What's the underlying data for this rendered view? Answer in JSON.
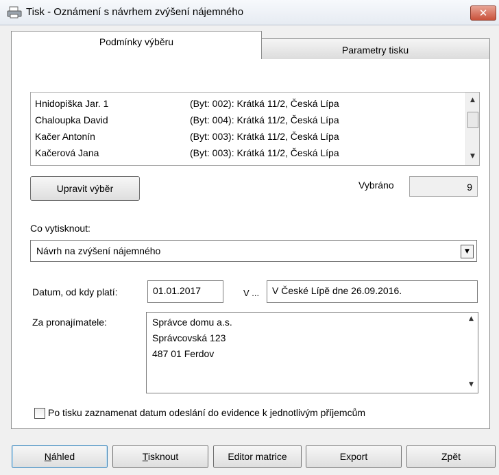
{
  "window": {
    "title": "Tisk - Oznámení s návrhem zvýšení nájemného",
    "close_glyph": "✕"
  },
  "tabs": [
    {
      "label": "Podmínky výběru",
      "active": true
    },
    {
      "label": "Parametry tisku",
      "active": false
    }
  ],
  "list": {
    "rows": [
      {
        "name": "Hnidopiška Jar. 1",
        "address": "(Byt: 002): Krátká 11/2, Česká Lípa"
      },
      {
        "name": "Chaloupka David",
        "address": "(Byt: 004): Krátká 11/2, Česká Lípa"
      },
      {
        "name": "Kačer Antonín",
        "address": "(Byt: 003): Krátká 11/2, Česká Lípa"
      },
      {
        "name": "Kačerová Jana",
        "address": "(Byt: 003): Krátká 11/2, Česká Lípa"
      }
    ],
    "scroll_up": "▲",
    "scroll_down": "▼"
  },
  "selection": {
    "edit_button": "Upravit výběr",
    "selected_label": "Vybráno",
    "selected_count": "9"
  },
  "print_what": {
    "label": "Co vytisknout:",
    "value": "Návrh na zvýšení nájemného",
    "dropdown_glyph": "▼"
  },
  "date": {
    "label": "Datum, od kdy platí:",
    "value": "01.01.2017",
    "place_label": "V ...",
    "place_value": "V České Lípě dne 26.09.2016."
  },
  "landlord": {
    "label": "Za pronajímatele:",
    "lines": [
      "Správce domu a.s.",
      "Správcovská 123",
      "487 01 Ferdov"
    ]
  },
  "checkbox": {
    "label": "Po tisku zaznamenat datum odeslání do evidence k jednotlivým příjemcům",
    "checked": false
  },
  "buttons": {
    "preview_mnemonic": "N",
    "preview_rest": "áhled",
    "print_mnemonic": "T",
    "print_rest": "isknout",
    "matrix_editor": "Editor matrice",
    "export": "Export",
    "back": "Zpět"
  },
  "colors": {
    "close_button": "#c9523b",
    "active_button_border": "#3c7fb1"
  }
}
